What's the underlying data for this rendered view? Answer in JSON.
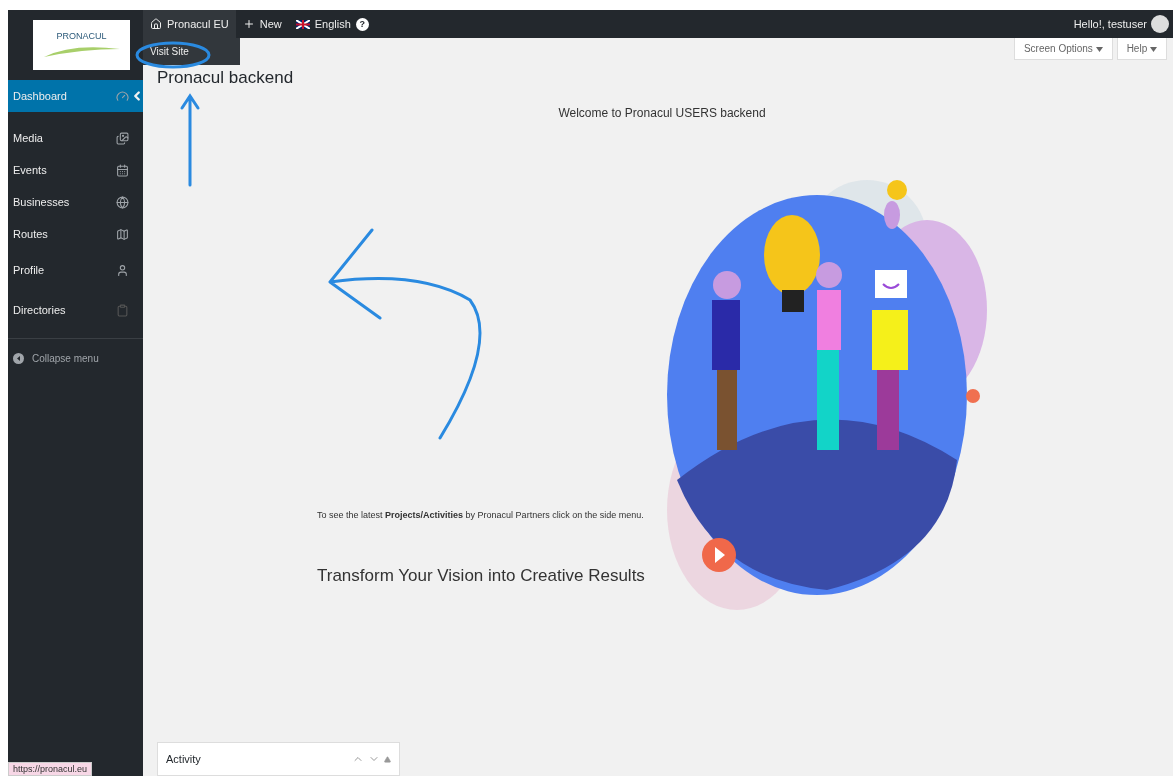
{
  "admin_bar": {
    "site": "Pronacul EU",
    "new": "New",
    "language": "English",
    "help": "?",
    "greeting": "Hello!, testuser",
    "dropdown": [
      "Visit Site"
    ]
  },
  "logo": {
    "text": "PRONACUL"
  },
  "sidebar": {
    "items": [
      {
        "label": "Dashboard",
        "selected": true
      },
      {
        "label": "Media",
        "selected": false
      },
      {
        "label": "Events",
        "selected": false
      },
      {
        "label": "Businesses",
        "selected": false
      },
      {
        "label": "Routes",
        "selected": false
      },
      {
        "label": "Profile",
        "selected": false
      },
      {
        "label": "Directories",
        "selected": false
      }
    ],
    "collapse": "Collapse menu"
  },
  "screen_meta": [
    "Screen Options",
    "Help"
  ],
  "page_title": "Pronacul backend",
  "welcome": "Welcome to Pronacul USERS backend",
  "intro": "To see the latest **Projects/Activities** by Pronacul Partners click on the side menu.",
  "headline": "Transform Your Vision into Creative Results",
  "activity": {
    "title": "Activity"
  },
  "status_url": "https://pronacul.eu"
}
